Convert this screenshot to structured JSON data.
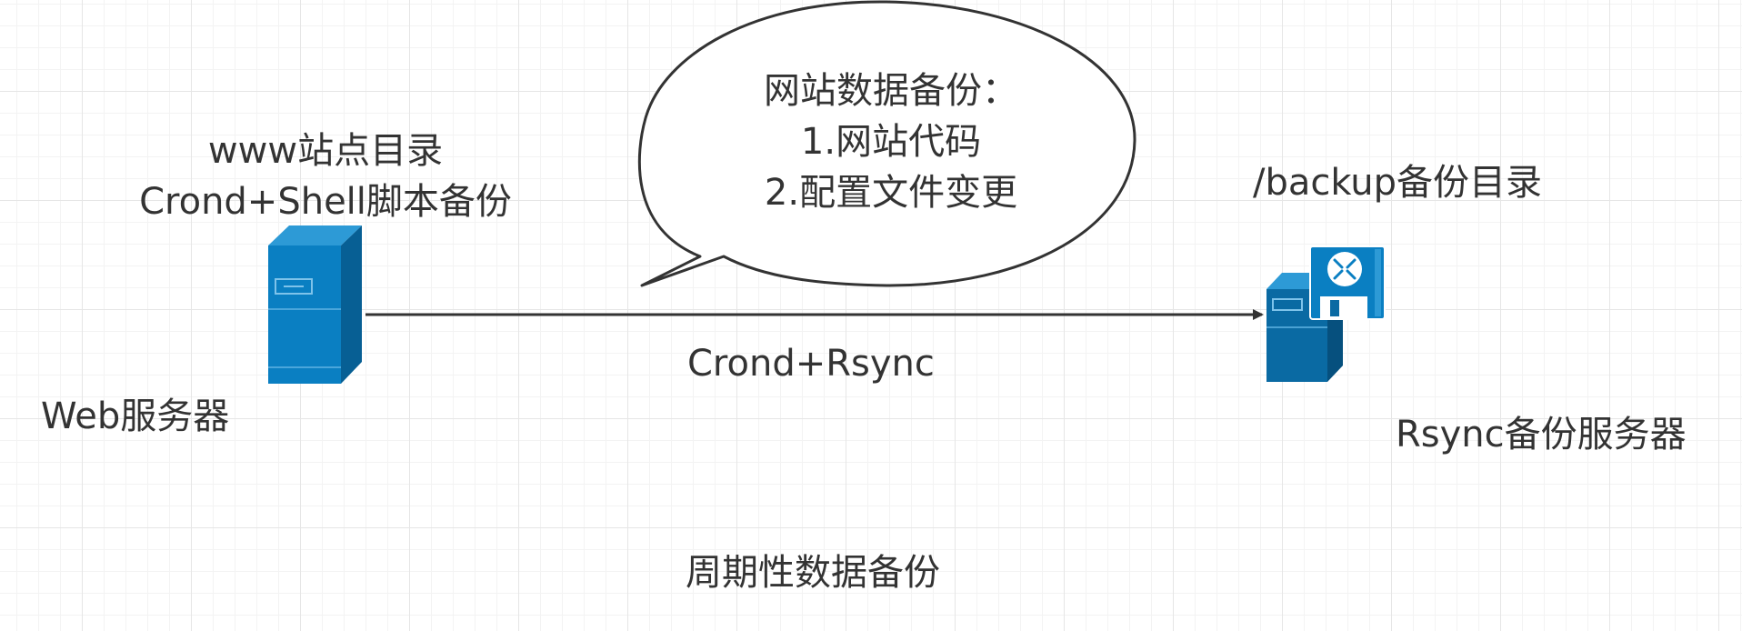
{
  "diagram": {
    "web_server": {
      "dir_label": "www站点目录",
      "script_label": "Crond+Shell脚本备份",
      "name": "Web服务器",
      "icon": "server-icon"
    },
    "backup_server": {
      "dir_label": "/backup备份目录",
      "name": "Rsync备份服务器",
      "icon": "backup-server-icon"
    },
    "callout": {
      "title": "网站数据备份：",
      "item1": "1.网站代码",
      "item2": "2.配置文件变更"
    },
    "connector": {
      "label": "Crond+Rsync",
      "direction": "web-to-backup"
    },
    "caption": "周期性数据备份",
    "colors": {
      "server_front": "#0a7fc2",
      "server_side": "#075f94",
      "server_top": "#2d9ad6",
      "line": "#333333",
      "text": "#333333",
      "grid": "#e6e6e6"
    }
  }
}
